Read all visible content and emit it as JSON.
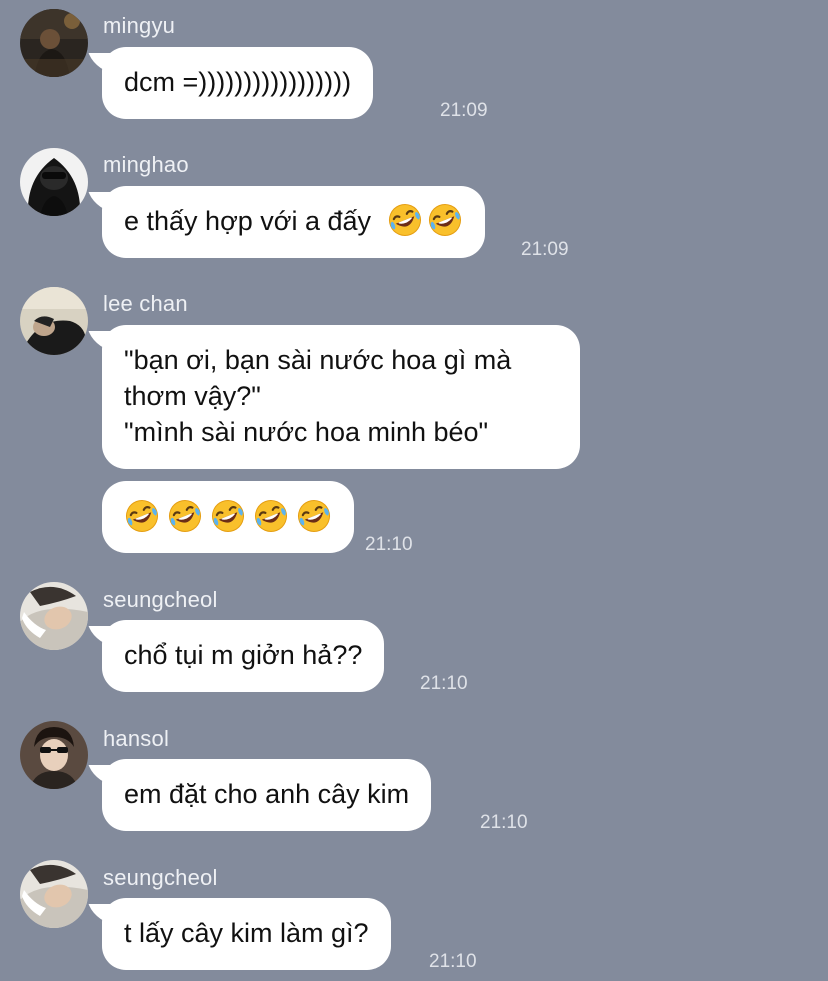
{
  "messages": [
    {
      "sender": "mingyu",
      "avatar_icon": "mingyu-avatar",
      "text": "dcm =)))))))))))))))))",
      "time": "21:09"
    },
    {
      "sender": "minghao",
      "avatar_icon": "minghao-avatar",
      "text": "e thấy hợp với a đấy",
      "emoji": [
        "rofl-emoji",
        "rofl-emoji"
      ],
      "time": "21:09"
    },
    {
      "sender": "lee chan",
      "avatar_icon": "leechan-avatar",
      "lines": [
        "\"bạn ơi, bạn sài nước hoa gì mà",
        "thơm vậy?\"",
        "\"mình sài nước hoa minh béo\""
      ]
    },
    {
      "emoji": [
        "rofl-emoji",
        "rofl-emoji",
        "rofl-emoji",
        "rofl-emoji",
        "rofl-emoji"
      ],
      "time": "21:10"
    },
    {
      "sender": "seungcheol",
      "avatar_icon": "seungcheol-avatar",
      "text": "chổ tụi m giởn hả??",
      "time": "21:10"
    },
    {
      "sender": "hansol",
      "avatar_icon": "hansol-avatar",
      "text": "em đặt cho anh cây kim",
      "time": "21:10"
    },
    {
      "sender": "seungcheol",
      "avatar_icon": "seungcheol-avatar",
      "text": "t lấy cây kim làm gì?",
      "time": "21:10"
    }
  ],
  "colors": {
    "background": "#838b9c",
    "bubble": "#ffffff",
    "sender_text": "#eef0f4",
    "time_text": "#dfe2e8"
  }
}
